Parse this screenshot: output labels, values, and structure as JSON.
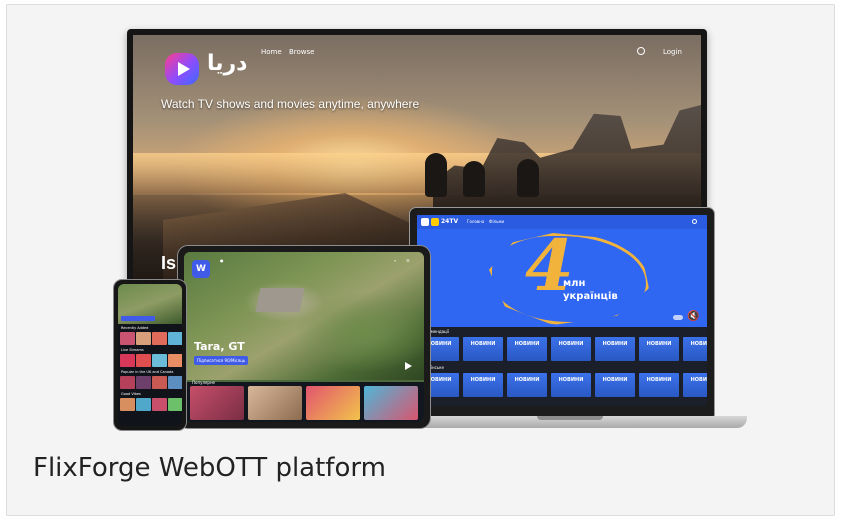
{
  "caption": "FlixForge WebOTT platform",
  "tv": {
    "brand": "دریا",
    "nav": [
      "Home",
      "Browse"
    ],
    "login": "Login",
    "tagline": "Watch TV shows and movies anytime, anywhere",
    "title_peek": "Is"
  },
  "laptop": {
    "brand": "24TV",
    "nav": [
      "Головна",
      "Фільми"
    ],
    "headline_number": "4",
    "headline_line1": "млн",
    "headline_line2": "українців",
    "row1_label": "Рекомендації",
    "row2_label": "Українське",
    "tile_label": "НОВИНИ"
  },
  "tablet": {
    "logo": "W",
    "title": "Tara, GT",
    "subscribe": "Підписатися 90/Місяць",
    "row_label": "Популярне"
  },
  "phone": {
    "rows": [
      "Recently Added",
      "Live Streams",
      "Popular in the UK and Canada",
      "Good Vibes"
    ]
  },
  "colors": {
    "accent_blue": "#3f5be8",
    "map_yellow": "#f2b33c",
    "laptop_bg": "#2f66f2"
  }
}
